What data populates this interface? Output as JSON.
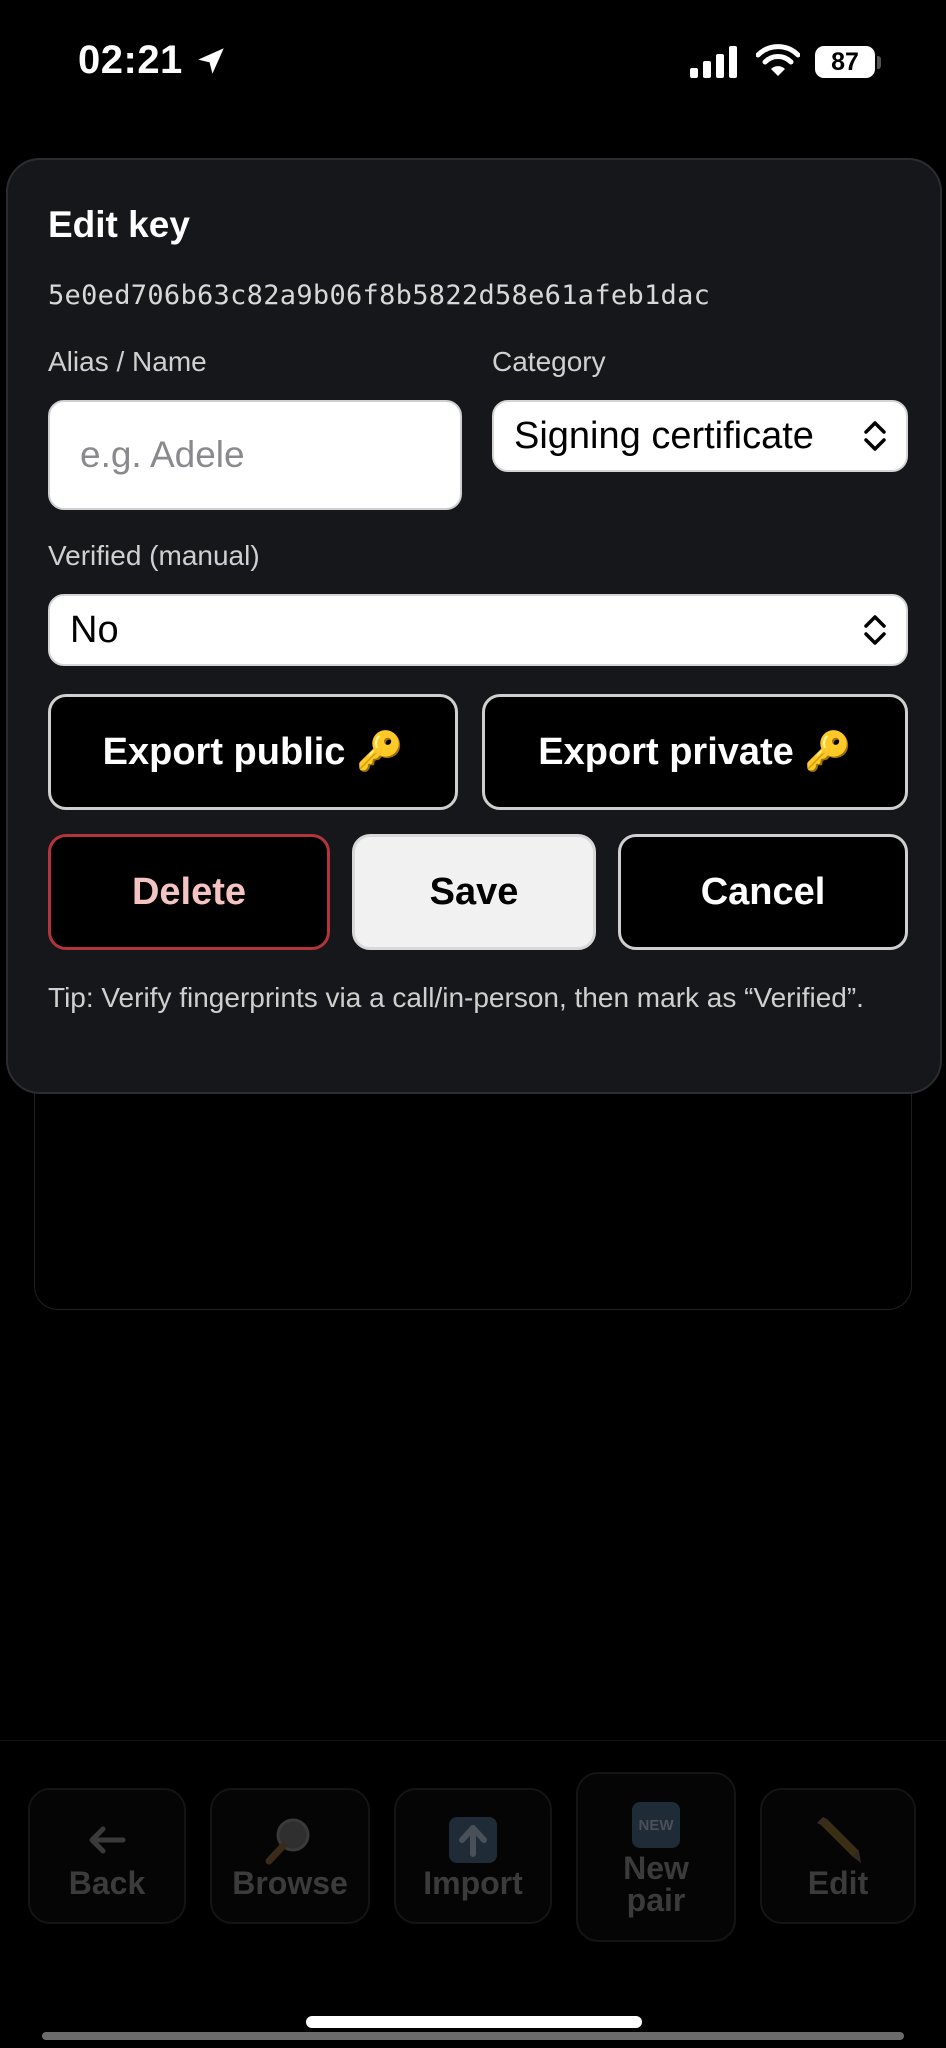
{
  "status_bar": {
    "time": "02:21",
    "battery": "87"
  },
  "modal": {
    "title": "Edit key",
    "fingerprint": "5e0ed706b63c82a9b06f8b5822d58e61afeb1dac",
    "alias_label": "Alias / Name",
    "alias_placeholder": "e.g. Adele",
    "alias_value": "",
    "category_label": "Category",
    "category_value": "Signing certificate",
    "verified_label": "Verified (manual)",
    "verified_value": "No",
    "export_public": "Export public 🔑",
    "export_private": "Export private 🔑",
    "delete": "Delete",
    "save": "Save",
    "cancel": "Cancel",
    "tip": "Tip: Verify fingerprints via a call/in-person, then mark as “Verified”."
  },
  "toolbar": {
    "back": "Back",
    "browse": "Browse",
    "import": "Import",
    "new_pair": "New pair",
    "new_badge": "NEW",
    "edit": "Edit"
  },
  "icons": [
    "location-arrow-icon",
    "signal-icon",
    "wifi-icon",
    "battery-icon",
    "chevron-updown-icon",
    "arrow-left-icon",
    "magnifier-icon",
    "upload-icon",
    "new-badge-icon",
    "pencil-icon"
  ]
}
